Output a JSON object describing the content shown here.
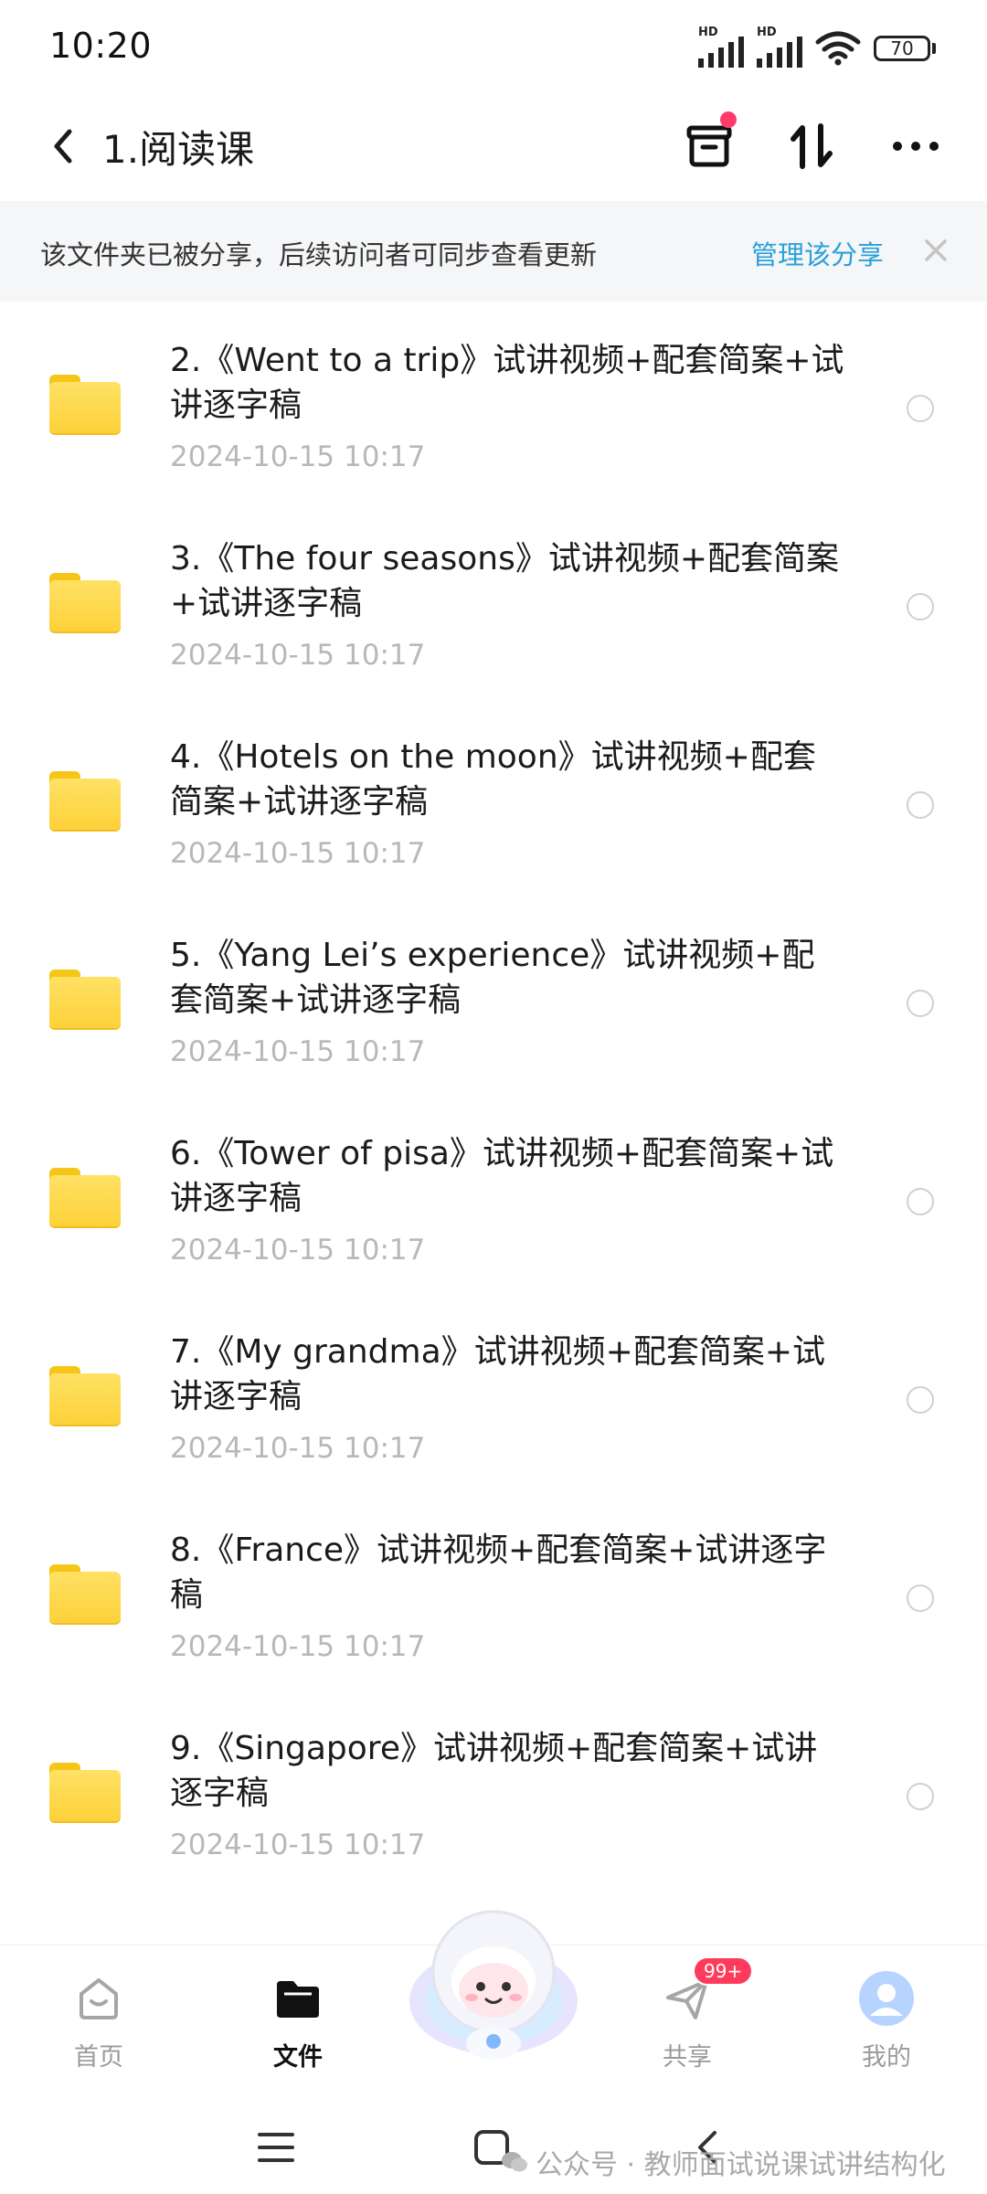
{
  "status_bar": {
    "time": "10:20",
    "signal1_label": "HD",
    "signal2_label": "HD",
    "battery": "70"
  },
  "header": {
    "title": "1.阅读课"
  },
  "banner": {
    "text": "该文件夹已被分享，后续访问者可同步查看更新",
    "link": "管理该分享"
  },
  "files": [
    {
      "name": "2.《Went to a trip》试讲视频+配套简案+试讲逐字稿",
      "date": "2024-10-15  10:17"
    },
    {
      "name": "3.《The four seasons》试讲视频+配套简案+试讲逐字稿",
      "date": "2024-10-15  10:17"
    },
    {
      "name": "4.《Hotels on the moon》试讲视频+配套简案+试讲逐字稿",
      "date": "2024-10-15  10:17"
    },
    {
      "name": "5.《Yang Lei’s experience》试讲视频+配套简案+试讲逐字稿",
      "date": "2024-10-15  10:17"
    },
    {
      "name": "6.《Tower of pisa》试讲视频+配套简案+试讲逐字稿",
      "date": "2024-10-15  10:17"
    },
    {
      "name": "7.《My grandma》试讲视频+配套简案+试讲逐字稿",
      "date": "2024-10-15  10:17"
    },
    {
      "name": "8.《France》试讲视频+配套简案+试讲逐字稿",
      "date": "2024-10-15  10:17"
    },
    {
      "name": "9.《Singapore》试讲视频+配套简案+试讲逐字稿",
      "date": "2024-10-15  10:17"
    }
  ],
  "bottom_nav": {
    "home": "首页",
    "files": "文件",
    "share": "共享",
    "share_badge": "99+",
    "me": "我的"
  },
  "watermark": "公众号 · 教师面试说课试讲结构化",
  "colors": {
    "accent_link": "#2aa0d8",
    "badge": "#ff3b5c",
    "folder": "#fdd13a"
  }
}
